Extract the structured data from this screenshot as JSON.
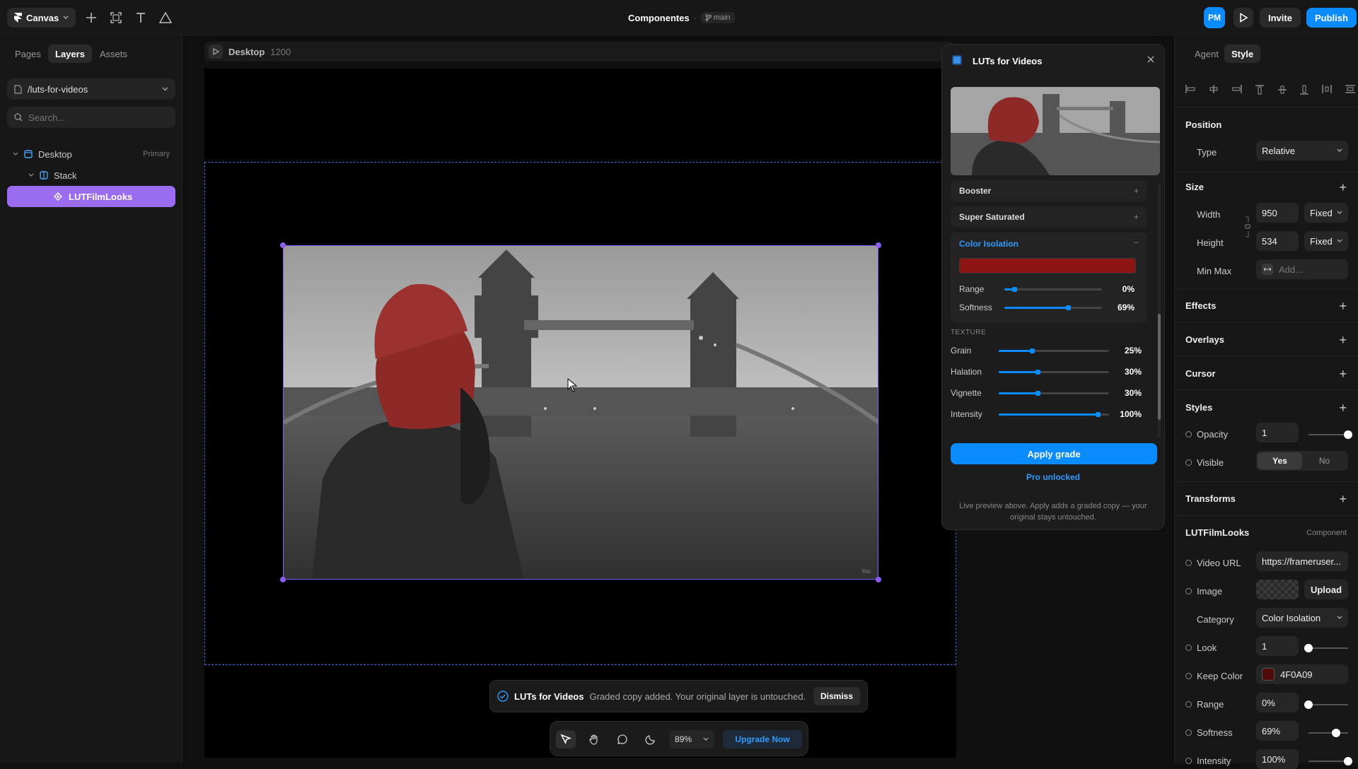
{
  "topbar": {
    "app_menu": "Canvas",
    "project_title": "Componentes",
    "branch": "main",
    "avatar_initials": "PM",
    "invite_label": "Invite",
    "publish_label": "Publish"
  },
  "left_panel": {
    "tabs": [
      "Pages",
      "Layers",
      "Assets"
    ],
    "active_tab": "Layers",
    "page_path": "/luts-for-videos",
    "search_placeholder": "Search...",
    "layers": [
      {
        "label": "Desktop",
        "badge": "Primary"
      },
      {
        "label": "Stack",
        "badge": ""
      },
      {
        "label": "LUTFilmLooks",
        "badge": ""
      }
    ]
  },
  "canvas": {
    "frame_label": "Desktop",
    "frame_width": "1200",
    "watermark": "Yoo"
  },
  "lut_panel": {
    "title": "LUTs for Videos",
    "presets": [
      {
        "label": "Booster",
        "control": "+"
      },
      {
        "label": "Super Saturated",
        "control": "+"
      },
      {
        "label": "Color Isolation",
        "control": "−"
      }
    ],
    "keep_color": "#8b1412",
    "isolation_sliders": [
      {
        "label": "Range",
        "value": "0%",
        "level": 0.1
      },
      {
        "label": "Softness",
        "value": "69%",
        "level": 0.65
      }
    ],
    "texture_heading": "TEXTURE",
    "texture_sliders": [
      {
        "label": "Grain",
        "value": "25%",
        "level": 0.3
      },
      {
        "label": "Halation",
        "value": "30%",
        "level": 0.35
      },
      {
        "label": "Vignette",
        "value": "30%",
        "level": 0.35
      },
      {
        "label": "Intensity",
        "value": "100%",
        "level": 0.9
      }
    ],
    "apply_label": "Apply grade",
    "pro_label": "Pro unlocked",
    "footnote": "Live preview above. Apply adds a graded copy — your original stays untouched."
  },
  "toast": {
    "app": "LUTs for Videos",
    "message": "Graded copy added. Your original layer is untouched.",
    "dismiss": "Dismiss"
  },
  "bottom_toolbar": {
    "zoom": "89%",
    "upgrade": "Upgrade Now"
  },
  "right_panel": {
    "tabs": [
      "Agent",
      "Style"
    ],
    "active_tab": "Style",
    "position": {
      "title": "Position",
      "type_label": "Type",
      "type_value": "Relative"
    },
    "size": {
      "title": "Size",
      "width_label": "Width",
      "width_value": "950",
      "width_mode": "Fixed",
      "height_label": "Height",
      "height_value": "534",
      "height_mode": "Fixed",
      "minmax_label": "Min Max",
      "minmax_placeholder": "Add..."
    },
    "sections": [
      "Effects",
      "Overlays",
      "Cursor"
    ],
    "styles": {
      "title": "Styles",
      "opacity_label": "Opacity",
      "opacity_value": "1",
      "opacity_level": 1.0,
      "visible_label": "Visible",
      "visible_yes": "Yes",
      "visible_no": "No"
    },
    "transforms_title": "Transforms",
    "component": {
      "title": "LUTFilmLooks",
      "badge": "Component",
      "video_url_label": "Video URL",
      "video_url_value": "https://frameruser...",
      "image_label": "Image",
      "upload_label": "Upload",
      "category_label": "Category",
      "category_value": "Color Isolation",
      "look_label": "Look",
      "look_value": "1",
      "look_level": 0.0,
      "keep_color_label": "Keep Color",
      "keep_color_value": "4F0A09",
      "keep_color_swatch": "#4f0a09",
      "range_label": "Range",
      "range_value": "0%",
      "range_level": 0.0,
      "softness_label": "Softness",
      "softness_value": "69%",
      "softness_level": 0.69,
      "intensity_label": "Intensity",
      "intensity_value": "100%",
      "intensity_level": 1.0
    }
  },
  "colors": {
    "accent": "#0a8cff",
    "selection": "#8b5cf6",
    "layer_highlight": "#9b6cf0"
  }
}
